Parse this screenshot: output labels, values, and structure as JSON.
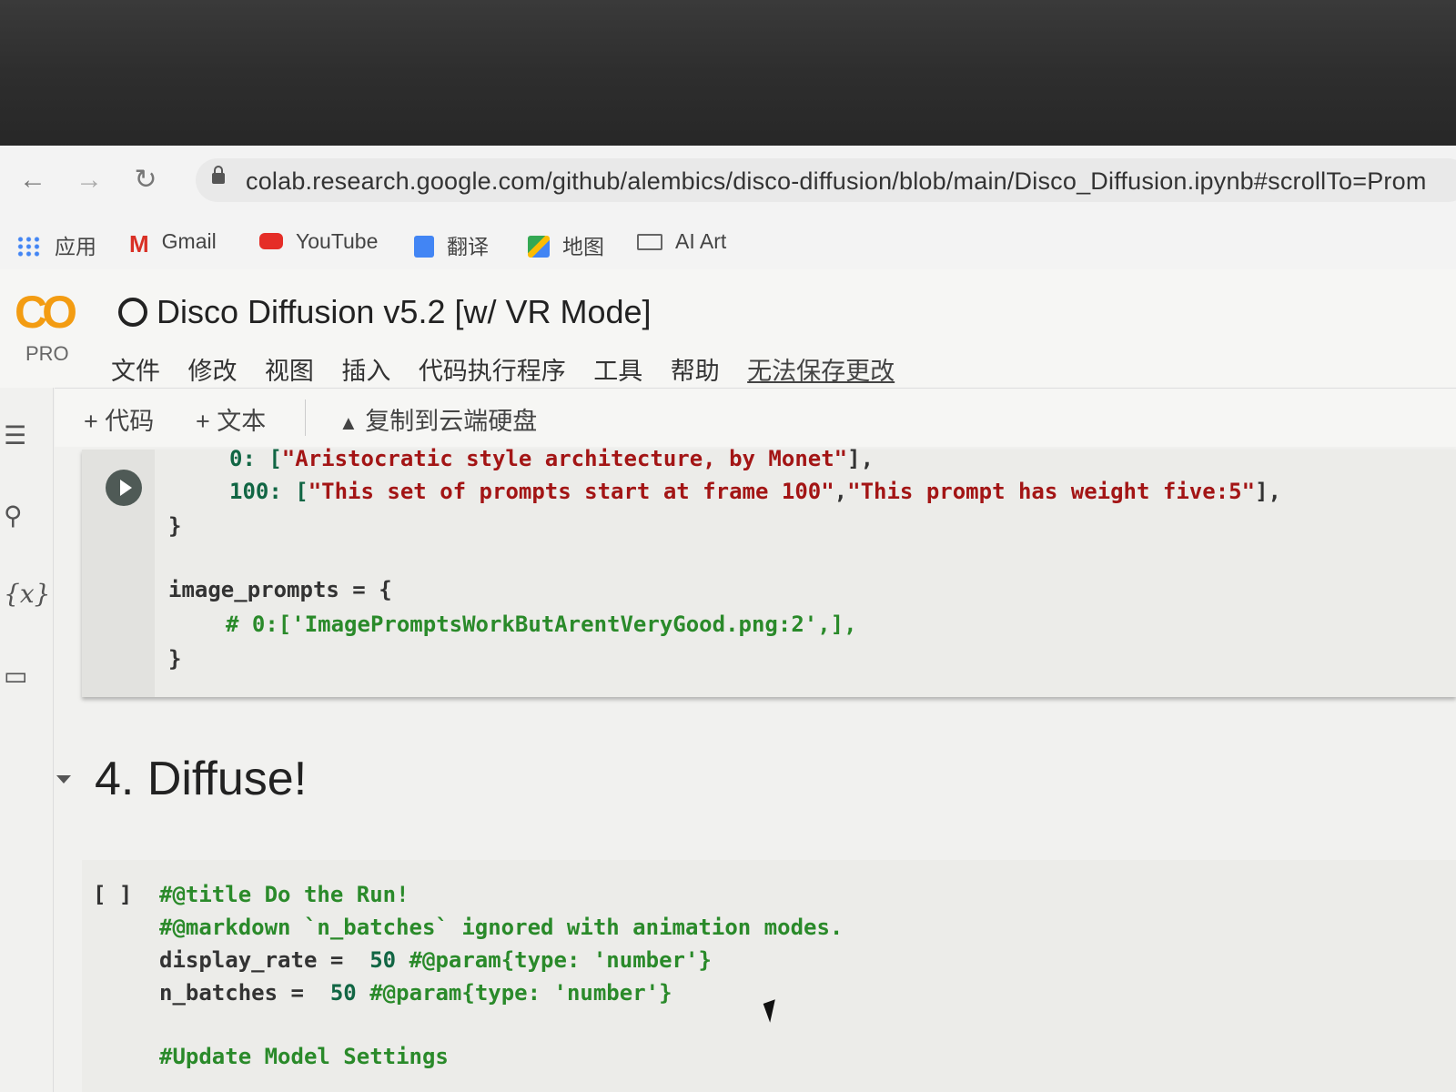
{
  "browser": {
    "url": "colab.research.google.com/github/alembics/disco-diffusion/blob/main/Disco_Diffusion.ipynb#scrollTo=Prom",
    "bookmarks": [
      {
        "label": "应用",
        "icon": "apps-grid-icon"
      },
      {
        "label": "Gmail",
        "icon": "gmail-icon"
      },
      {
        "label": "YouTube",
        "icon": "youtube-icon"
      },
      {
        "label": "翻译",
        "icon": "translate-icon"
      },
      {
        "label": "地图",
        "icon": "maps-icon"
      },
      {
        "label": "AI Art",
        "icon": "folder-icon"
      }
    ]
  },
  "colab": {
    "logo": "CO",
    "plan": "PRO",
    "title": "Disco Diffusion v5.2 [w/ VR Mode]",
    "menu": [
      "文件",
      "修改",
      "视图",
      "插入",
      "代码执行程序",
      "工具",
      "帮助"
    ],
    "save_warning": "无法保存更改",
    "toolbar": {
      "add_code": "+ 代码",
      "add_text": "+ 文本",
      "copy_drive": "复制到云端硬盘"
    }
  },
  "cell1": {
    "line1_key": "0: [",
    "line1_str": "\"Aristocratic style architecture, by Monet\"",
    "line1_tail": "],",
    "line2_key": "100: [",
    "line2_str_a": "\"This set of prompts start at frame 100\"",
    "line2_sep": ",",
    "line2_str_b": "\"This prompt has weight five:5\"",
    "line2_tail": "],",
    "close1": "}",
    "image_prompts": "image_prompts = {",
    "comment": "# 0:['ImagePromptsWorkButArentVeryGood.png:2',],",
    "close2": "}"
  },
  "section": {
    "title": "4. Diffuse!"
  },
  "cell2": {
    "bracket": "[ ]",
    "line1": "#@title Do the Run!",
    "line2": "#@markdown `n_batches` ignored with animation modes.",
    "line3_var": "display_rate =",
    "line3_val": "50",
    "line3_param": "#@param{type: 'number'}",
    "line4_var": "n_batches =",
    "line4_val": "50",
    "line4_param": "#@param{type: 'number'}",
    "line5": "#Update Model Settings"
  }
}
